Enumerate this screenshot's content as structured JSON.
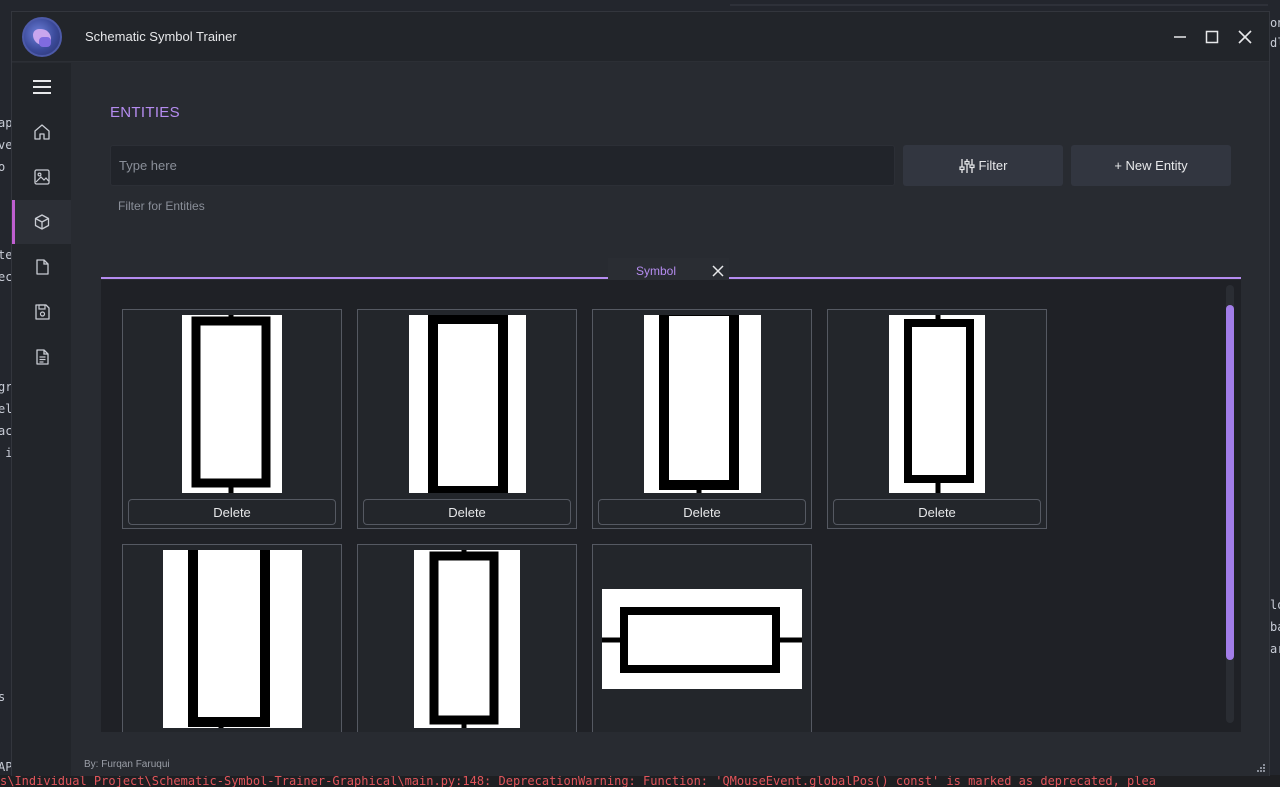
{
  "window": {
    "title": "Schematic Symbol Trainer",
    "controls": {
      "minimize": "minimize-icon",
      "maximize": "maximize-icon",
      "close": "close-icon"
    }
  },
  "sidebar": {
    "items": [
      {
        "name": "menu",
        "icon": "hamburger-menu-icon"
      },
      {
        "name": "home",
        "icon": "home-icon"
      },
      {
        "name": "images",
        "icon": "image-icon"
      },
      {
        "name": "entities",
        "icon": "cube-icon",
        "active": true
      },
      {
        "name": "documents",
        "icon": "file-icon"
      },
      {
        "name": "save",
        "icon": "save-icon"
      },
      {
        "name": "report",
        "icon": "file-text-icon"
      }
    ]
  },
  "main": {
    "title": "ENTITIES",
    "search": {
      "placeholder": "Type here",
      "value": ""
    },
    "filter_button": "Filter",
    "new_entity_button": "+ New Entity",
    "filter_hint": "Filter for Entities"
  },
  "tabs": [
    {
      "label": "Symbol",
      "closable": true
    }
  ],
  "symbols": [
    {
      "delete_label": "Delete",
      "orientation": "vertical"
    },
    {
      "delete_label": "Delete",
      "orientation": "vertical"
    },
    {
      "delete_label": "Delete",
      "orientation": "vertical"
    },
    {
      "delete_label": "Delete",
      "orientation": "vertical"
    },
    {
      "orientation": "vertical"
    },
    {
      "orientation": "vertical"
    },
    {
      "orientation": "horizontal"
    }
  ],
  "footer": {
    "credit": "By: Furqan Faruqui"
  },
  "background": {
    "terminal_text": "s\\Individual Project\\Schematic-Symbol-Trainer-Graphical\\main.py:148: DeprecationWarning: Function: 'QMouseEvent.globalPos() const' is marked as deprecated, plea"
  },
  "colors": {
    "accent": "#b58cf0",
    "active_indicator": "#bf5fd0",
    "window_bg": "#282b31",
    "panel_bg": "#1f2126",
    "terminal_text": "#e2555b"
  }
}
